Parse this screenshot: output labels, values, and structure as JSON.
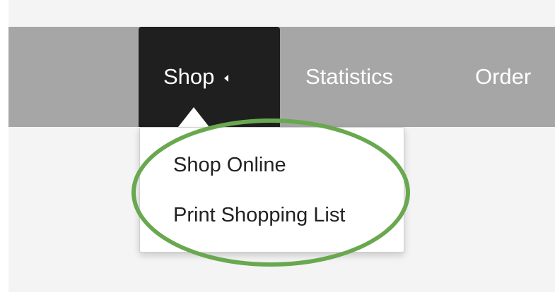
{
  "nav": {
    "items": [
      {
        "label": "Shop",
        "active": true
      },
      {
        "label": "Statistics",
        "active": false
      },
      {
        "label": "Order",
        "active": false
      }
    ]
  },
  "dropdown": {
    "items": [
      {
        "label": "Shop Online"
      },
      {
        "label": "Print Shopping List"
      }
    ]
  },
  "colors": {
    "nav_bar": "#a6a6a6",
    "active_item": "#1f1f1f",
    "highlight_ring": "#69a84f"
  },
  "icons": {
    "shop_caret": "caret-left-icon"
  }
}
